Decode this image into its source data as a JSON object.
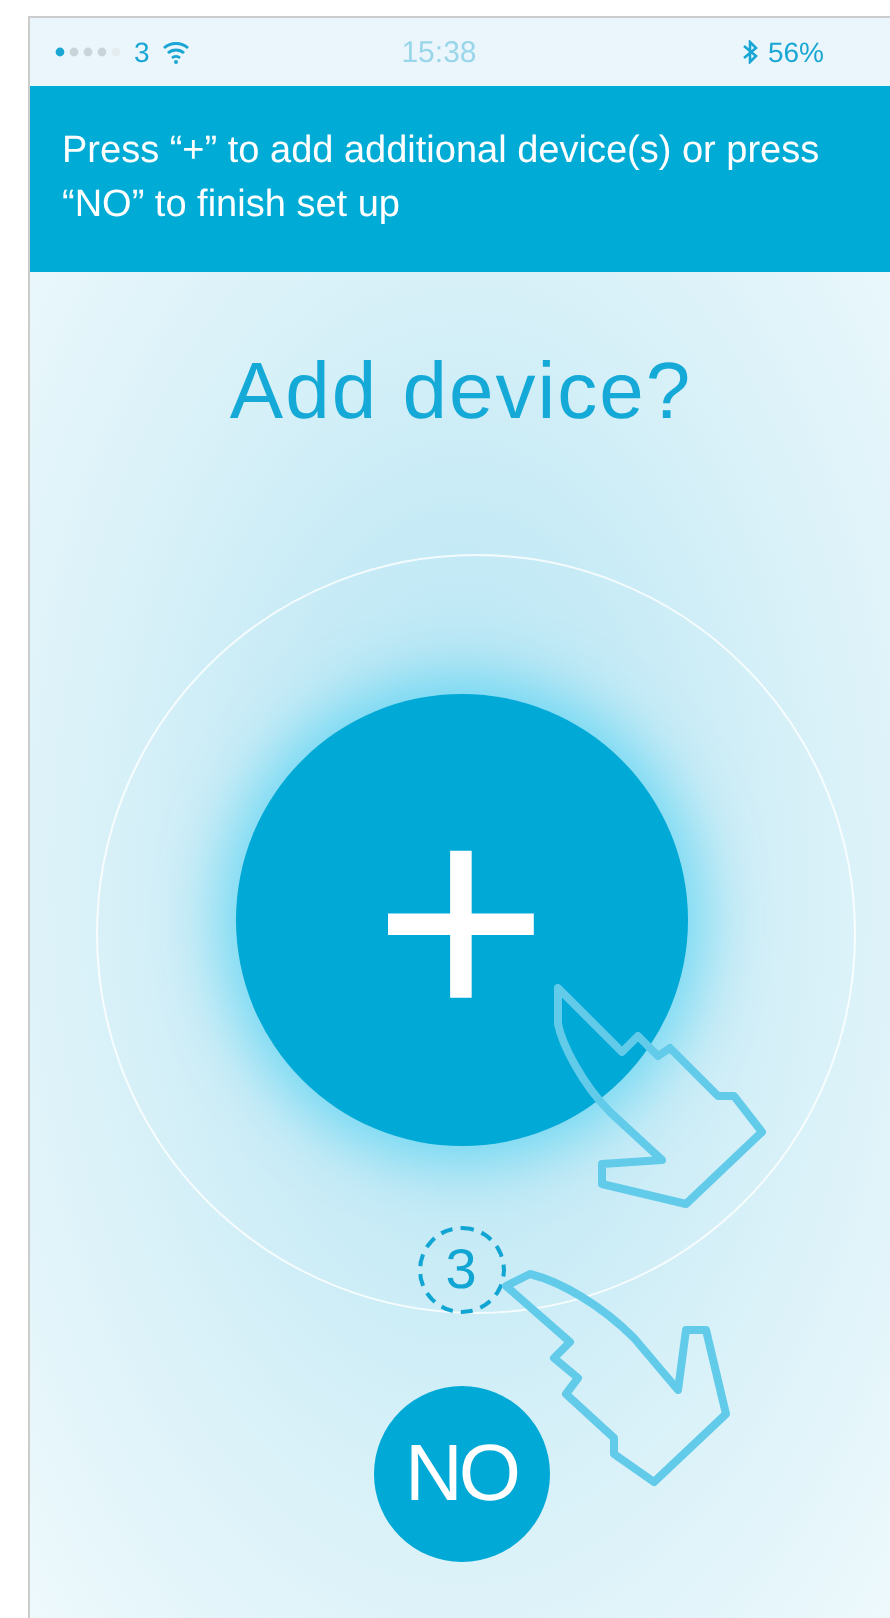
{
  "status_bar": {
    "carrier": "3",
    "time": "15:38",
    "battery": "56%"
  },
  "banner": {
    "text": "Press “+” to add additional device(s) or press “NO” to finish set up"
  },
  "title": "Add device?",
  "add_button": {
    "label": "+"
  },
  "step_badge": "3",
  "no_button": {
    "label": "NO"
  }
}
